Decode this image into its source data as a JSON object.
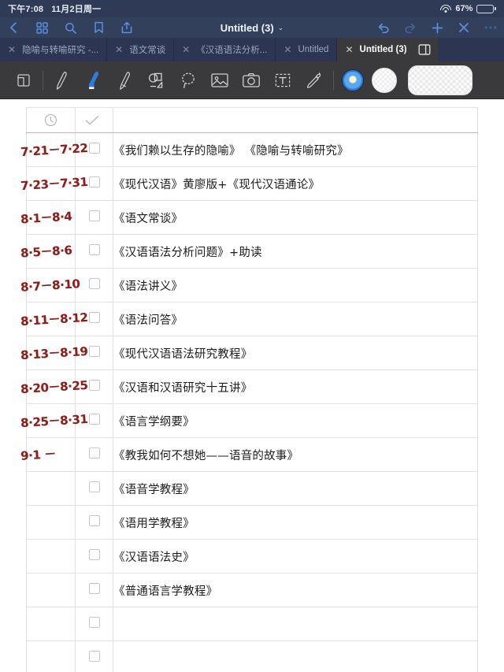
{
  "statusbar": {
    "time": "下午7:08",
    "date": "11月2日周一",
    "battery_percent": "67%",
    "wifi_icon": "wifi-icon",
    "battery_icon": "battery-icon"
  },
  "navbar": {
    "title": "Untitled (3)",
    "title_chevron": "⌄",
    "left_icons": [
      {
        "name": "back-chevron-icon",
        "label": "Back"
      },
      {
        "name": "grid-thumbnails-icon",
        "label": "Page Thumbnails"
      },
      {
        "name": "search-icon",
        "label": "Search"
      },
      {
        "name": "bookmark-icon",
        "label": "Bookmark"
      },
      {
        "name": "share-icon",
        "label": "Share"
      }
    ],
    "right_icons": [
      {
        "name": "undo-icon",
        "label": "Undo",
        "enabled": true
      },
      {
        "name": "redo-icon",
        "label": "Redo",
        "enabled": false
      },
      {
        "name": "add-icon",
        "label": "Add Page",
        "enabled": true
      },
      {
        "name": "close-icon",
        "label": "Close",
        "enabled": true
      },
      {
        "name": "more-icon",
        "label": "More",
        "enabled": true
      }
    ]
  },
  "tabbar": {
    "tabs": [
      {
        "label": "隐喻与转喻研究 -...",
        "active": false,
        "close": "✕"
      },
      {
        "label": "语文常谈",
        "active": false,
        "close": "✕"
      },
      {
        "label": "《汉语语法分析...",
        "active": false,
        "close": "✕"
      },
      {
        "label": "Untitled",
        "active": false,
        "close": "✕"
      },
      {
        "label": "Untitled (3)",
        "active": true,
        "close": "✕"
      }
    ],
    "panel_icon": "split-panel-icon"
  },
  "toolbar": {
    "tools": [
      {
        "name": "page-tool",
        "label": "Page"
      },
      {
        "name": "pen-tool",
        "label": "Pen",
        "active": false
      },
      {
        "name": "highlighter-tool",
        "label": "Highlighter",
        "active": true
      },
      {
        "name": "pencil-tool",
        "label": "Pencil",
        "active": false
      },
      {
        "name": "shape-tool",
        "label": "Shapes",
        "active": false
      },
      {
        "name": "lasso-tool",
        "label": "Lasso",
        "active": false
      },
      {
        "name": "image-tool",
        "label": "Insert Image",
        "active": false
      },
      {
        "name": "camera-tool",
        "label": "Camera",
        "active": false
      },
      {
        "name": "text-tool",
        "label": "Text Box",
        "active": false
      },
      {
        "name": "eyedropper-tool",
        "label": "Eyedropper",
        "active": false
      }
    ],
    "swatches": [
      {
        "name": "color-swatch-blue",
        "color": "#2d7ddb",
        "selected": true
      },
      {
        "name": "color-swatch-white",
        "color": "#ffffff",
        "selected": false
      },
      {
        "name": "color-swatch-wide-transparent",
        "color": "transparent",
        "selected": false
      }
    ],
    "active_color": "#2d7ddb"
  },
  "sheet": {
    "columns": [
      {
        "header_icon": "clock-icon",
        "name": "date-column"
      },
      {
        "header_icon": "checkmark-icon",
        "name": "checkbox-column"
      },
      {
        "header_icon": "",
        "name": "title-column"
      }
    ],
    "ink_color": "#8c1f1a",
    "rows": [
      {
        "date": "7·21－7·22",
        "checked": false,
        "title": "《我们赖以生存的隐喻》 《隐喻与转喻研究》"
      },
      {
        "date": "7·23－7·31",
        "checked": false,
        "title": "《现代汉语》黄廖版+《现代汉语通论》"
      },
      {
        "date": "8·1－8·4",
        "checked": false,
        "title": "《语文常谈》"
      },
      {
        "date": "8·5－8·6",
        "checked": false,
        "title": "《汉语语法分析问题》+助读"
      },
      {
        "date": "8·7－8·10",
        "checked": false,
        "title": "《语法讲义》"
      },
      {
        "date": "8·11－8·12",
        "checked": false,
        "title": "《语法问答》"
      },
      {
        "date": "8·13－8·19",
        "checked": false,
        "title": "《现代汉语语法研究教程》"
      },
      {
        "date": "8·20－8·25",
        "checked": false,
        "title": "《汉语和汉语研究十五讲》"
      },
      {
        "date": "8·25－8·31",
        "checked": false,
        "title": "《语言学纲要》"
      },
      {
        "date": "9·1 －",
        "checked": false,
        "title": "《教我如何不想她——语音的故事》"
      },
      {
        "date": "",
        "checked": false,
        "title": "《语音学教程》"
      },
      {
        "date": "",
        "checked": false,
        "title": "《语用学教程》"
      },
      {
        "date": "",
        "checked": false,
        "title": "《汉语语法史》"
      },
      {
        "date": "",
        "checked": false,
        "title": "《普通语言学教程》"
      },
      {
        "date": "",
        "checked": false,
        "title": ""
      },
      {
        "date": "",
        "checked": false,
        "title": ""
      }
    ]
  }
}
